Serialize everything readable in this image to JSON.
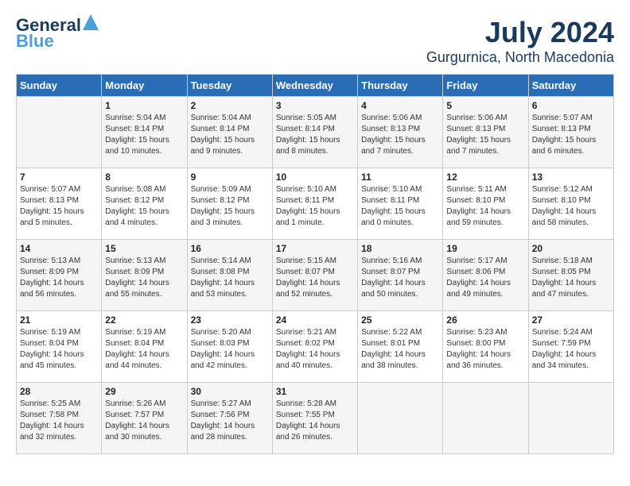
{
  "header": {
    "logo_line1": "General",
    "logo_line2": "Blue",
    "month": "July 2024",
    "location": "Gurgurnica, North Macedonia"
  },
  "days_of_week": [
    "Sunday",
    "Monday",
    "Tuesday",
    "Wednesday",
    "Thursday",
    "Friday",
    "Saturday"
  ],
  "weeks": [
    [
      {
        "day": "",
        "info": ""
      },
      {
        "day": "1",
        "info": "Sunrise: 5:04 AM\nSunset: 8:14 PM\nDaylight: 15 hours\nand 10 minutes."
      },
      {
        "day": "2",
        "info": "Sunrise: 5:04 AM\nSunset: 8:14 PM\nDaylight: 15 hours\nand 9 minutes."
      },
      {
        "day": "3",
        "info": "Sunrise: 5:05 AM\nSunset: 8:14 PM\nDaylight: 15 hours\nand 8 minutes."
      },
      {
        "day": "4",
        "info": "Sunrise: 5:06 AM\nSunset: 8:13 PM\nDaylight: 15 hours\nand 7 minutes."
      },
      {
        "day": "5",
        "info": "Sunrise: 5:06 AM\nSunset: 8:13 PM\nDaylight: 15 hours\nand 7 minutes."
      },
      {
        "day": "6",
        "info": "Sunrise: 5:07 AM\nSunset: 8:13 PM\nDaylight: 15 hours\nand 6 minutes."
      }
    ],
    [
      {
        "day": "7",
        "info": "Sunrise: 5:07 AM\nSunset: 8:13 PM\nDaylight: 15 hours\nand 5 minutes."
      },
      {
        "day": "8",
        "info": "Sunrise: 5:08 AM\nSunset: 8:12 PM\nDaylight: 15 hours\nand 4 minutes."
      },
      {
        "day": "9",
        "info": "Sunrise: 5:09 AM\nSunset: 8:12 PM\nDaylight: 15 hours\nand 3 minutes."
      },
      {
        "day": "10",
        "info": "Sunrise: 5:10 AM\nSunset: 8:11 PM\nDaylight: 15 hours\nand 1 minute."
      },
      {
        "day": "11",
        "info": "Sunrise: 5:10 AM\nSunset: 8:11 PM\nDaylight: 15 hours\nand 0 minutes."
      },
      {
        "day": "12",
        "info": "Sunrise: 5:11 AM\nSunset: 8:10 PM\nDaylight: 14 hours\nand 59 minutes."
      },
      {
        "day": "13",
        "info": "Sunrise: 5:12 AM\nSunset: 8:10 PM\nDaylight: 14 hours\nand 58 minutes."
      }
    ],
    [
      {
        "day": "14",
        "info": "Sunrise: 5:13 AM\nSunset: 8:09 PM\nDaylight: 14 hours\nand 56 minutes."
      },
      {
        "day": "15",
        "info": "Sunrise: 5:13 AM\nSunset: 8:09 PM\nDaylight: 14 hours\nand 55 minutes."
      },
      {
        "day": "16",
        "info": "Sunrise: 5:14 AM\nSunset: 8:08 PM\nDaylight: 14 hours\nand 53 minutes."
      },
      {
        "day": "17",
        "info": "Sunrise: 5:15 AM\nSunset: 8:07 PM\nDaylight: 14 hours\nand 52 minutes."
      },
      {
        "day": "18",
        "info": "Sunrise: 5:16 AM\nSunset: 8:07 PM\nDaylight: 14 hours\nand 50 minutes."
      },
      {
        "day": "19",
        "info": "Sunrise: 5:17 AM\nSunset: 8:06 PM\nDaylight: 14 hours\nand 49 minutes."
      },
      {
        "day": "20",
        "info": "Sunrise: 5:18 AM\nSunset: 8:05 PM\nDaylight: 14 hours\nand 47 minutes."
      }
    ],
    [
      {
        "day": "21",
        "info": "Sunrise: 5:19 AM\nSunset: 8:04 PM\nDaylight: 14 hours\nand 45 minutes."
      },
      {
        "day": "22",
        "info": "Sunrise: 5:19 AM\nSunset: 8:04 PM\nDaylight: 14 hours\nand 44 minutes."
      },
      {
        "day": "23",
        "info": "Sunrise: 5:20 AM\nSunset: 8:03 PM\nDaylight: 14 hours\nand 42 minutes."
      },
      {
        "day": "24",
        "info": "Sunrise: 5:21 AM\nSunset: 8:02 PM\nDaylight: 14 hours\nand 40 minutes."
      },
      {
        "day": "25",
        "info": "Sunrise: 5:22 AM\nSunset: 8:01 PM\nDaylight: 14 hours\nand 38 minutes."
      },
      {
        "day": "26",
        "info": "Sunrise: 5:23 AM\nSunset: 8:00 PM\nDaylight: 14 hours\nand 36 minutes."
      },
      {
        "day": "27",
        "info": "Sunrise: 5:24 AM\nSunset: 7:59 PM\nDaylight: 14 hours\nand 34 minutes."
      }
    ],
    [
      {
        "day": "28",
        "info": "Sunrise: 5:25 AM\nSunset: 7:58 PM\nDaylight: 14 hours\nand 32 minutes."
      },
      {
        "day": "29",
        "info": "Sunrise: 5:26 AM\nSunset: 7:57 PM\nDaylight: 14 hours\nand 30 minutes."
      },
      {
        "day": "30",
        "info": "Sunrise: 5:27 AM\nSunset: 7:56 PM\nDaylight: 14 hours\nand 28 minutes."
      },
      {
        "day": "31",
        "info": "Sunrise: 5:28 AM\nSunset: 7:55 PM\nDaylight: 14 hours\nand 26 minutes."
      },
      {
        "day": "",
        "info": ""
      },
      {
        "day": "",
        "info": ""
      },
      {
        "day": "",
        "info": ""
      }
    ]
  ]
}
